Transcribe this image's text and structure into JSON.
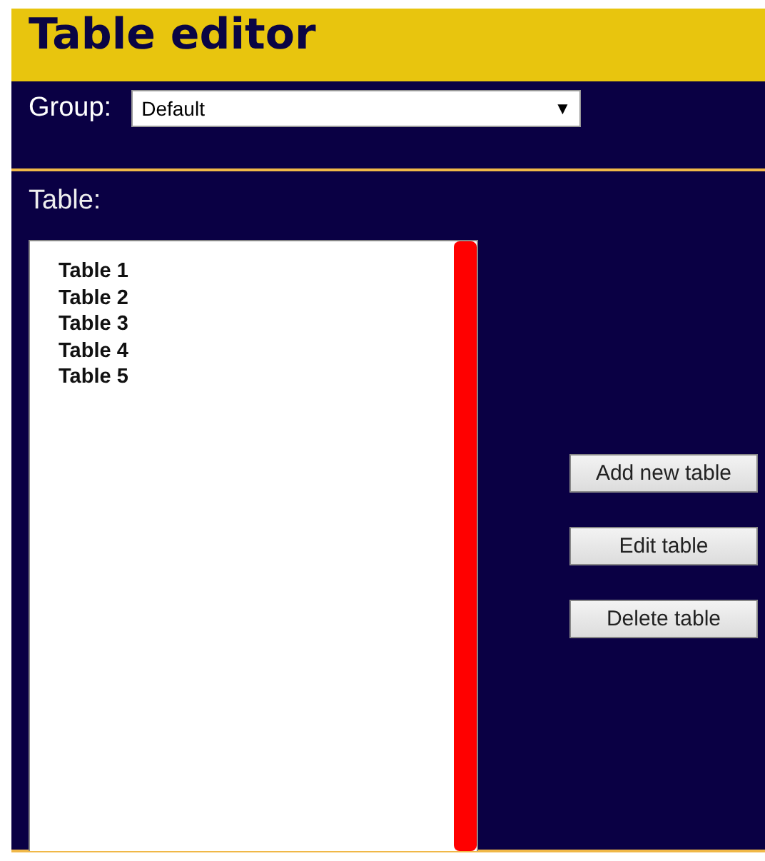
{
  "header": {
    "title": "Table editor"
  },
  "group": {
    "label": "Group:",
    "value": "Default",
    "arrow": "▼"
  },
  "table_section": {
    "label": "Table:",
    "items": [
      {
        "label": "Table 1"
      },
      {
        "label": "Table 2"
      },
      {
        "label": "Table 3"
      },
      {
        "label": "Table 4"
      },
      {
        "label": "Table 5"
      }
    ],
    "buttons": [
      {
        "label": "Add new table"
      },
      {
        "label": "Edit table"
      },
      {
        "label": "Delete table"
      }
    ]
  }
}
